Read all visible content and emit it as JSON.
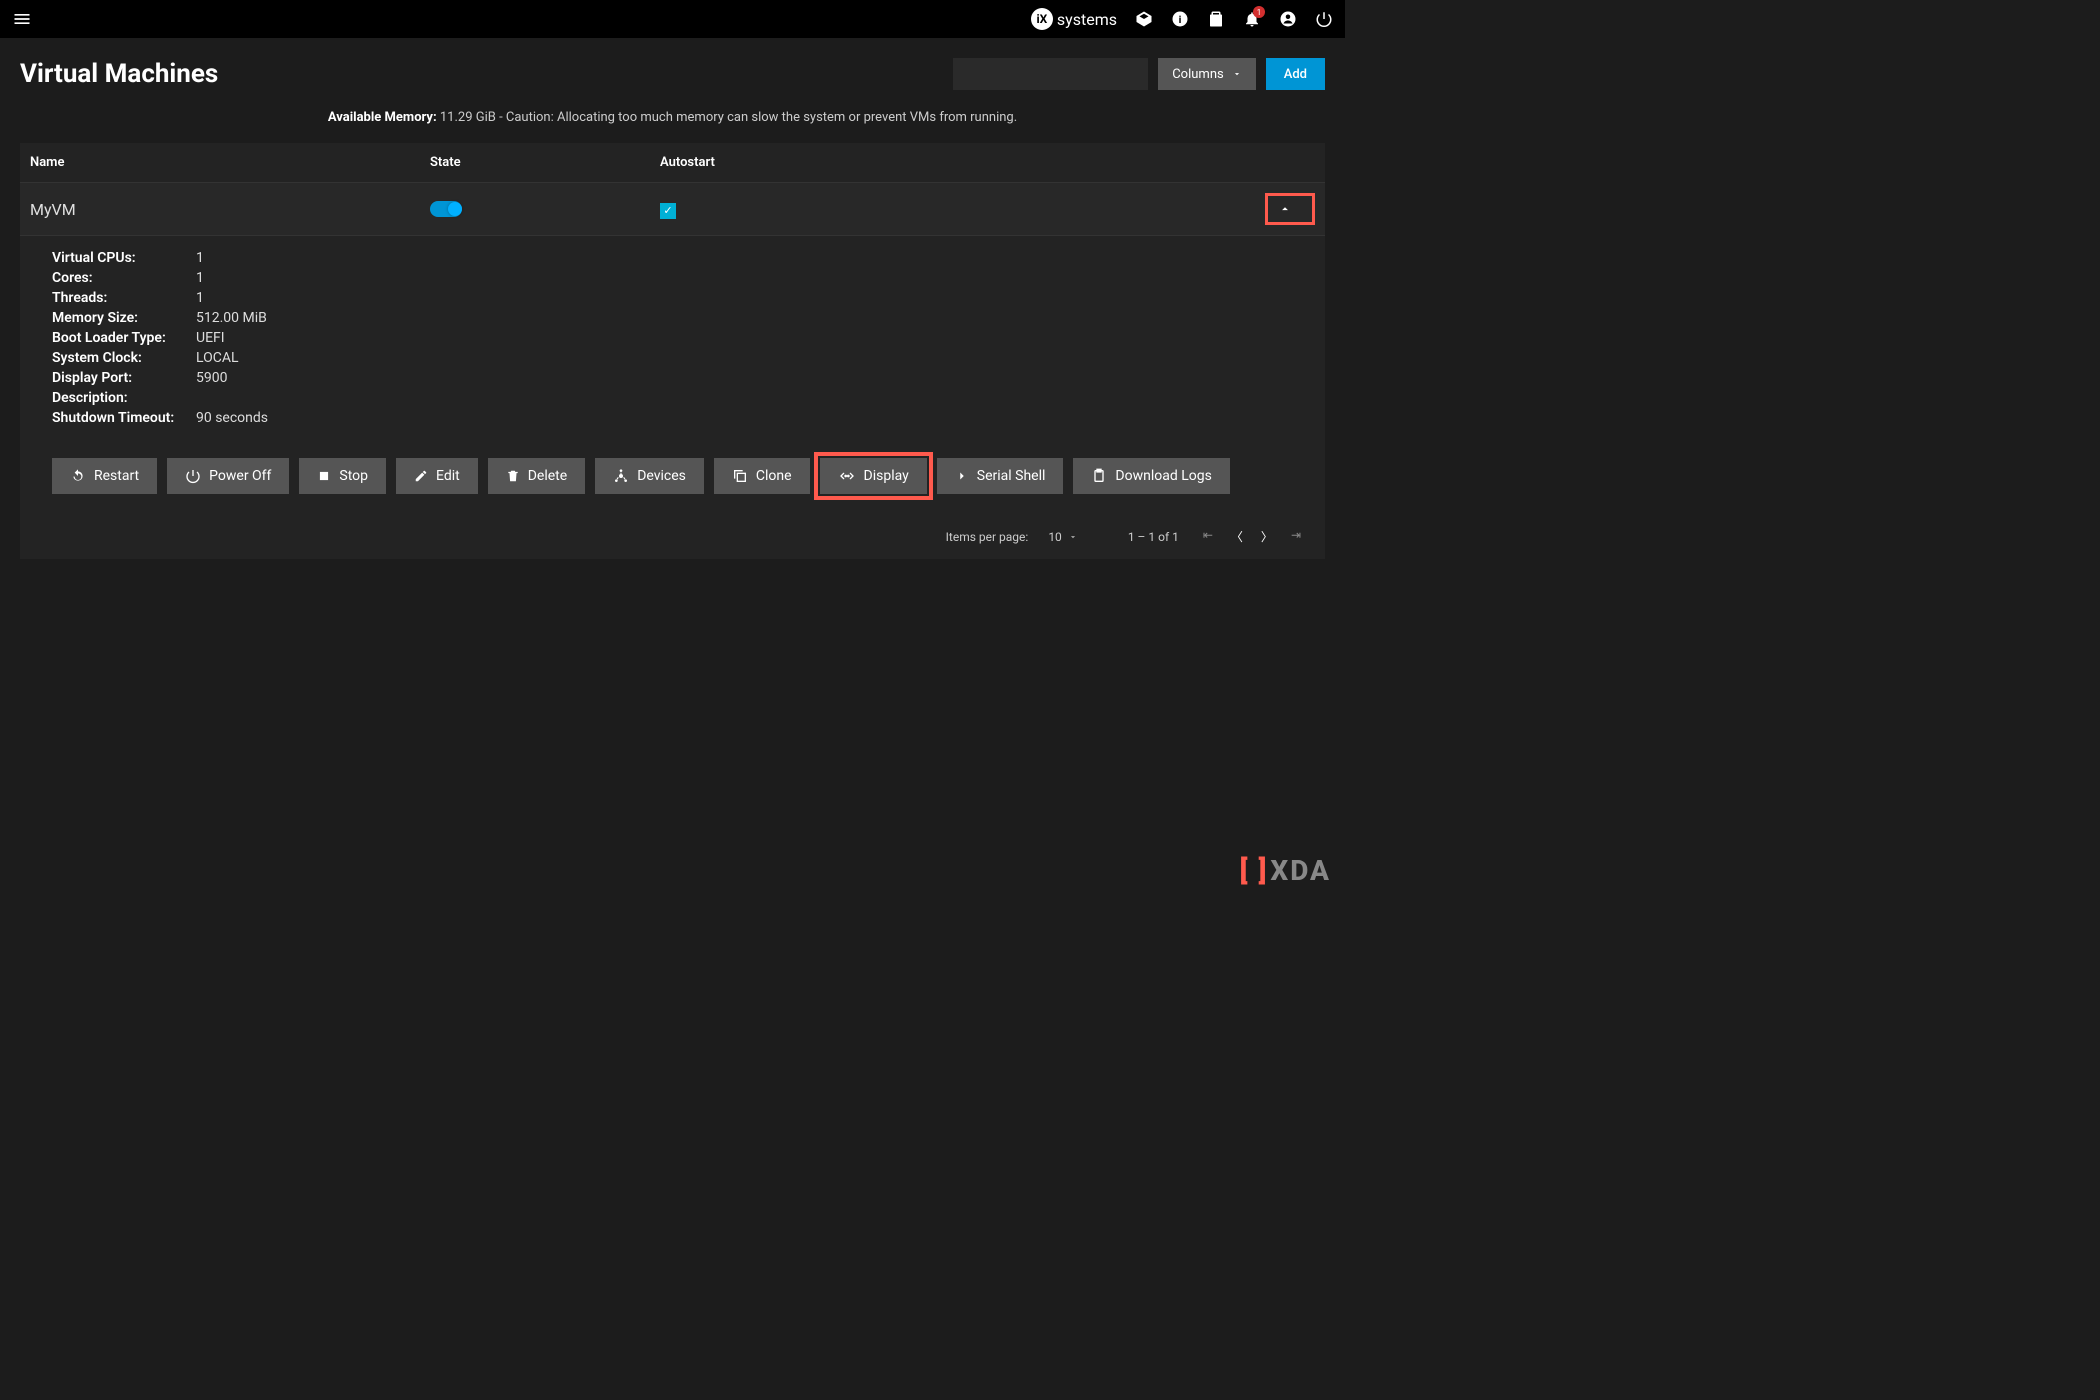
{
  "header": {
    "logo_text": "systems",
    "notification_count": "1"
  },
  "page": {
    "title": "Virtual Machines",
    "columns_label": "Columns",
    "add_label": "Add",
    "memory_label": "Available Memory:",
    "memory_value": "11.29 GiB - Caution: Allocating too much memory can slow the system or prevent VMs from running."
  },
  "table": {
    "headers": {
      "name": "Name",
      "state": "State",
      "autostart": "Autostart"
    },
    "row": {
      "name": "MyVM"
    }
  },
  "details": {
    "vcpus": {
      "label": "Virtual CPUs:",
      "value": "1"
    },
    "cores": {
      "label": "Cores:",
      "value": "1"
    },
    "threads": {
      "label": "Threads:",
      "value": "1"
    },
    "memory": {
      "label": "Memory Size:",
      "value": "512.00 MiB"
    },
    "boot": {
      "label": "Boot Loader Type:",
      "value": "UEFI"
    },
    "clock": {
      "label": "System Clock:",
      "value": "LOCAL"
    },
    "port": {
      "label": "Display Port:",
      "value": "5900"
    },
    "desc": {
      "label": "Description:",
      "value": ""
    },
    "shutdown": {
      "label": "Shutdown Timeout:",
      "value": "90 seconds"
    }
  },
  "actions": {
    "restart": "Restart",
    "poweroff": "Power Off",
    "stop": "Stop",
    "edit": "Edit",
    "delete": "Delete",
    "devices": "Devices",
    "clone": "Clone",
    "display": "Display",
    "serial": "Serial Shell",
    "logs": "Download Logs"
  },
  "pagination": {
    "items_label": "Items per page:",
    "items_value": "10",
    "range": "1 – 1 of 1"
  },
  "watermark": "XDA"
}
